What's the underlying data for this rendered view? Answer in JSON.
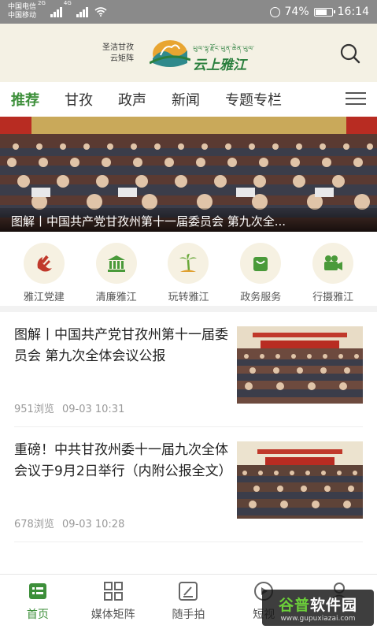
{
  "status_bar": {
    "carrier_1": "中国电信",
    "carrier_2": "中国移动",
    "net_1": "2G",
    "net_2": "4G",
    "battery": "74%",
    "battery_level": 0.74,
    "time": "16:14"
  },
  "header": {
    "slogan_line_1": "圣洁甘孜",
    "slogan_line_2": "云矩阵",
    "brand": "云上雅江",
    "tibetan": "ཡུལ་ལྷ་རྫོང་ཡུན་ཆེན་ཡུལ་"
  },
  "nav": {
    "tabs": [
      {
        "label": "推荐",
        "active": true
      },
      {
        "label": "甘孜",
        "active": false
      },
      {
        "label": "政声",
        "active": false
      },
      {
        "label": "新闻",
        "active": false
      },
      {
        "label": "专题专栏",
        "active": false
      }
    ]
  },
  "hero": {
    "caption": "图解丨中国共产党甘孜州第十一届委员会 第九次全..."
  },
  "quick": [
    {
      "label": "雅江党建",
      "icon": "party-emblem-icon"
    },
    {
      "label": "清廉雅江",
      "icon": "building-icon"
    },
    {
      "label": "玩转雅江",
      "icon": "palm-tree-icon"
    },
    {
      "label": "政务服务",
      "icon": "shopping-bag-icon"
    },
    {
      "label": "行摄雅江",
      "icon": "video-camera-icon"
    }
  ],
  "news": [
    {
      "title": "图解丨中国共产党甘孜州第十一届委员会 第九次全体会议公报",
      "views": "951浏览",
      "date": "09-03 10:31"
    },
    {
      "title": "重磅！中共甘孜州委十一届九次全体会议于9月2日举行（内附公报全文）",
      "views": "678浏览",
      "date": "09-03 10:28"
    }
  ],
  "tabbar": [
    {
      "label": "首页",
      "icon": "home-icon",
      "active": true
    },
    {
      "label": "媒体矩阵",
      "icon": "grid-icon",
      "active": false
    },
    {
      "label": "随手拍",
      "icon": "edit-icon",
      "active": false
    },
    {
      "label": "短视",
      "icon": "play-icon",
      "active": false
    },
    {
      "label": "",
      "icon": "user-icon",
      "active": false
    }
  ],
  "watermark": {
    "main_a": "谷普",
    "main_b": "软件园",
    "url": "www.gupuxiazai.com"
  },
  "colors": {
    "accent": "#3d8f3a",
    "header_bg": "#f4f1e4",
    "status_bar": "#8a8a8a"
  }
}
